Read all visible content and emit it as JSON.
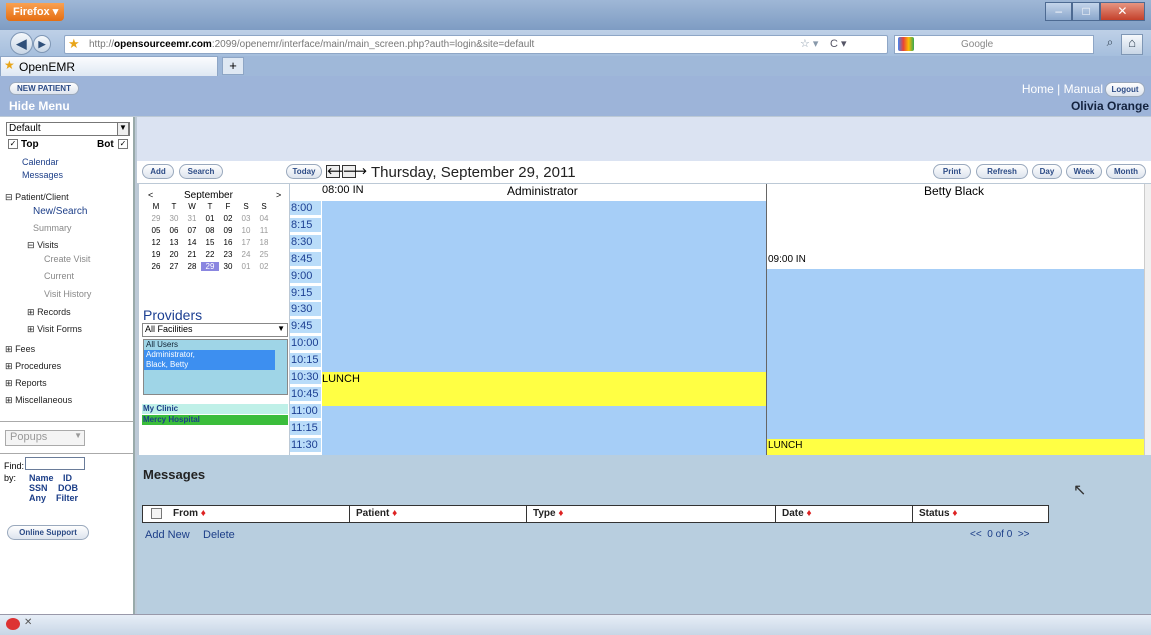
{
  "browser": {
    "app_button": "Firefox",
    "url_prefix": "http://",
    "url_domain": "opensourceemr.com",
    "url_rest": ":2099/openemr/interface/main/main_screen.php?auth=login&site=default",
    "search_engine": "Google",
    "tab_title": "OpenEMR",
    "new_tab": "+"
  },
  "header": {
    "new_patient": "NEW PATIENT",
    "hide_menu": "Hide Menu",
    "home": "Home",
    "separator": "|",
    "manual": "Manual",
    "logout": "Logout",
    "user": "Olivia Orange"
  },
  "nav": {
    "layout_select": "Default",
    "top": "Top",
    "bot": "Bot",
    "calendar": "Calendar",
    "messages": "Messages",
    "patient_client": "Patient/Client",
    "new_search": "New/Search",
    "summary": "Summary",
    "visits": "Visits",
    "create_visit": "Create Visit",
    "current": "Current",
    "visit_history": "Visit History",
    "records": "Records",
    "visit_forms": "Visit Forms",
    "fees": "Fees",
    "procedures": "Procedures",
    "reports": "Reports",
    "miscellaneous": "Miscellaneous",
    "popups": "Popups",
    "find": "Find:",
    "by": "by:",
    "name": "Name",
    "id": "ID",
    "ssn": "SSN",
    "dob": "DOB",
    "any": "Any",
    "filter": "Filter",
    "online_support": "Online Support"
  },
  "toolbar": {
    "add": "Add",
    "search": "Search",
    "today": "Today",
    "date_title": "Thursday, September 29, 2011",
    "print": "Print",
    "refresh": "Refresh",
    "day": "Day",
    "week": "Week",
    "month": "Month"
  },
  "minical": {
    "prev": "<",
    "month": "September",
    "next": ">",
    "weekdays": [
      "M",
      "T",
      "W",
      "T",
      "F",
      "S",
      "S"
    ],
    "weeks": [
      [
        "29",
        "30",
        "31",
        "01",
        "02",
        "03",
        "04"
      ],
      [
        "05",
        "06",
        "07",
        "08",
        "09",
        "10",
        "11"
      ],
      [
        "12",
        "13",
        "14",
        "15",
        "16",
        "17",
        "18"
      ],
      [
        "19",
        "20",
        "21",
        "22",
        "23",
        "24",
        "25"
      ],
      [
        "26",
        "27",
        "28",
        "29",
        "30",
        "01",
        "02"
      ]
    ],
    "selected": "29"
  },
  "providers": {
    "title": "Providers",
    "facility_select": "All Facilities",
    "options": [
      "All Users",
      "Administrator,",
      "Black, Betty"
    ],
    "facilities": [
      "My Clinic",
      "Mercy Hospital"
    ]
  },
  "schedule": {
    "header_time": "08:00 IN",
    "columns": [
      "Administrator",
      "Betty Black"
    ],
    "times": [
      "8:00",
      "8:15",
      "8:30",
      "8:45",
      "9:00",
      "9:15",
      "9:30",
      "9:45",
      "10:00",
      "10:15",
      "10:30",
      "10:45",
      "11:00",
      "11:15",
      "11:30"
    ],
    "admin_lunch": "LUNCH",
    "betty_event": "09:00 IN",
    "betty_lunch": "LUNCH",
    "colors": {
      "slot": "#a6cef7",
      "lunch": "#ffff44",
      "time": "#b9dcf9"
    }
  },
  "messages": {
    "title": "Messages",
    "columns": [
      "From",
      "Patient",
      "Type",
      "Date",
      "Status"
    ],
    "add_new": "Add New",
    "delete": "Delete",
    "pagination": "<<  0 of 0  >>"
  }
}
